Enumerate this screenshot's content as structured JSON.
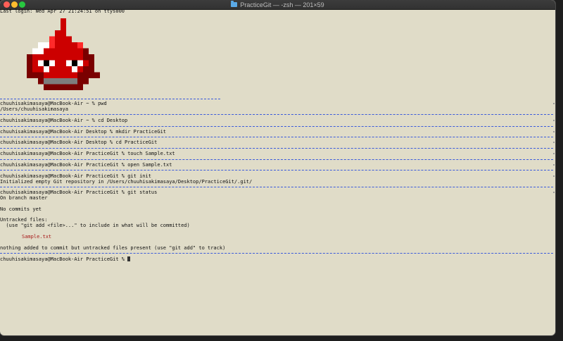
{
  "window": {
    "title": "PracticeGit — -zsh — 201×59"
  },
  "terminal": {
    "last_login": "Last login: Wed Apr 27 21:24:51 on ttys000",
    "blocks": [
      {
        "prompt": "chuuhisakimasaya@MacBook-Air ~ % pwd",
        "output": [
          "/Users/chuuhisakimasaya"
        ]
      },
      {
        "prompt": "chuuhisakimasaya@MacBook-Air ~ % cd Desktop",
        "output": []
      },
      {
        "prompt": "chuuhisakimasaya@MacBook-Air Desktop % mkdir PracticeGit",
        "output": []
      },
      {
        "prompt": "chuuhisakimasaya@MacBook-Air Desktop % cd PracticeGit",
        "output": []
      },
      {
        "prompt": "chuuhisakimasaya@MacBook-Air PracticeGit % touch Sample.txt",
        "output": []
      },
      {
        "prompt": "chuuhisakimasaya@MacBook-Air PracticeGit % open Sample.txt",
        "output": []
      },
      {
        "prompt": "chuuhisakimasaya@MacBook-Air PracticeGit % git init",
        "output": [
          "Initialized empty Git repository in /Users/chuuhisakimasaya/Desktop/PracticeGit/.git/"
        ]
      },
      {
        "prompt": "chuuhisakimasaya@MacBook-Air PracticeGit % git status",
        "output": [
          "On branch master"
        ]
      }
    ],
    "status": {
      "no_commits": "No commits yet",
      "untracked_header": "Untracked files:",
      "untracked_hint": "  (use \"git add <file>...\" to include in what will be committed)",
      "untracked_file": "Sample.txt",
      "summary": "nothing added to commit but untracked files present (use \"git add\" to track)"
    },
    "current_prompt": "chuuhisakimasaya@MacBook-Air PracticeGit % "
  },
  "colors": {
    "background": "#e0dcc8",
    "separator": "#3b5bdb",
    "untracked": "#a81c1c",
    "sprite_red": "#cc0000",
    "sprite_dark": "#7a0000"
  }
}
